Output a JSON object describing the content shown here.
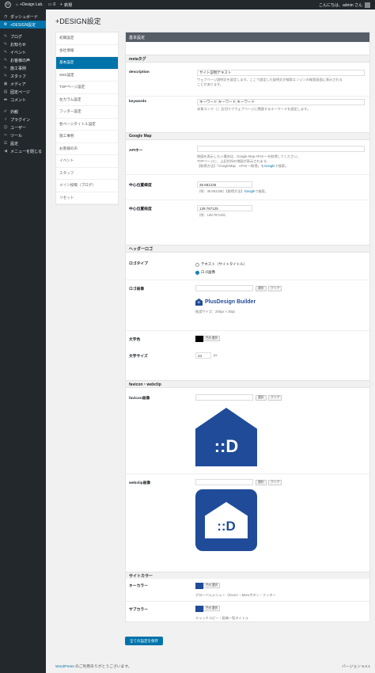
{
  "adminbar": {
    "wp_logo": "W",
    "site_name": "+Design Lab.",
    "comments_count": "0",
    "new_label": "新規",
    "greeting": "こんにちは、admin さん"
  },
  "menu": {
    "items": [
      {
        "label": "ダッシュボード",
        "icon": "dashboard-icon"
      },
      {
        "label": "+DESIGN設定",
        "icon": "gear-icon"
      },
      {
        "label": "ブログ",
        "icon": "pin-icon"
      },
      {
        "label": "お知らせ",
        "icon": "pin-icon"
      },
      {
        "label": "イベント",
        "icon": "pin-icon"
      },
      {
        "label": "お客様の声",
        "icon": "pin-icon"
      },
      {
        "label": "施工事例",
        "icon": "pin-icon"
      },
      {
        "label": "スタッフ",
        "icon": "pin-icon"
      },
      {
        "label": "メディア",
        "icon": "media-icon"
      },
      {
        "label": "固定ページ",
        "icon": "page-icon"
      },
      {
        "label": "コメント",
        "icon": "comment-icon"
      },
      {
        "label": "外観",
        "icon": "brush-icon"
      },
      {
        "label": "プラグイン",
        "icon": "plugin-icon"
      },
      {
        "label": "ユーザー",
        "icon": "user-icon"
      },
      {
        "label": "ツール",
        "icon": "wrench-icon"
      },
      {
        "label": "設定",
        "icon": "settings-icon"
      },
      {
        "label": "メニューを閉じる",
        "icon": "collapse-icon"
      }
    ]
  },
  "page_title": "+DESIGN設定",
  "subnav": [
    "初期設定",
    "会社情報",
    "基本設定",
    "SNS設定",
    "TOPページ設定",
    "左カラム設定",
    "フッター設定",
    "各ページタイトル設定",
    "施工事例",
    "お客様の声",
    "イベント",
    "スタッフ",
    "メイン投稿（ブログ）",
    "リセット"
  ],
  "main": {
    "header": "基本設定",
    "meta": {
      "section": "metaタグ",
      "description_label": "description",
      "description_value": "サイト説明テキスト",
      "description_help1": "ウェブページ説明文を設定します。ここで設定した説明文が検索エンジンの検索画面に表示される",
      "description_help2": "ことがあります。",
      "keywords_label": "keywords",
      "keywords_value": "キーワード,キーワード,キーワード",
      "keywords_help": "半角コンマ（,）区切りでウェブページに関連するキーワードを設定します。"
    },
    "gmap": {
      "section": "Google Map",
      "apikey_label": "APIキー",
      "apikey_help1": "地図を表示したい場合は、Google Map APIキーを取得してください。",
      "apikey_help2": "TOPページに、上記住所の地図が表示されます。",
      "apikey_help3a": "【取得方法】「GoogleMap　APIキー取得」を",
      "apikey_help3b": "Google",
      "apikey_help3c": "で検索。",
      "lat_label": "中心位置緯度",
      "lat_value": "35.681236",
      "lat_help_a": "（例：35.681236）【取得方法】",
      "lat_help_b": "Google",
      "lat_help_c": "で検索。",
      "lng_label": "中心位置経度",
      "lng_value": "139.767125",
      "lng_help": "（例：139.767125）"
    },
    "header_logo": {
      "section": "ヘッダーロゴ",
      "type_label": "ロゴタイプ",
      "opt_text": "テキスト（サイトタイトル）",
      "opt_image": "ロゴ画像",
      "image_label": "ロゴ画像",
      "select_btn": "選択",
      "clear_btn": "クリア",
      "logo_text": "PlusDesign Builder",
      "logo_size": "推奨サイズ：200px × 30px",
      "color_label": "文字色",
      "color_btn": "色を選択",
      "color_value": "#000000",
      "fontsize_label": "文字サイズ",
      "fontsize_value": "24",
      "fontsize_unit": "px"
    },
    "favicon": {
      "section": "favicon・webclip",
      "favicon_label": "favicon画像",
      "webclip_label": "webclip画像",
      "select_btn": "選択",
      "clear_btn": "クリア",
      "brand_color": "#1f4b99",
      "icon_text": "::D"
    },
    "site_color": {
      "section": "サイトカラー",
      "key_label": "キーカラー",
      "key_btn": "色を選択",
      "key_color": "#1f4b99",
      "key_help": "グローバルメニュー（hover）・Moreボタン・フッター",
      "sub_label": "サブカラー",
      "sub_btn": "色を選択",
      "sub_color": "#1f4b99",
      "sub_help": "キャッチコピー・投稿一覧タイトル"
    }
  },
  "save_button": "全ての設定を保存",
  "footer": {
    "left_link": "WordPress",
    "left_text": " のご利用ありがとうございます。",
    "version": "バージョン 5.2.1"
  }
}
